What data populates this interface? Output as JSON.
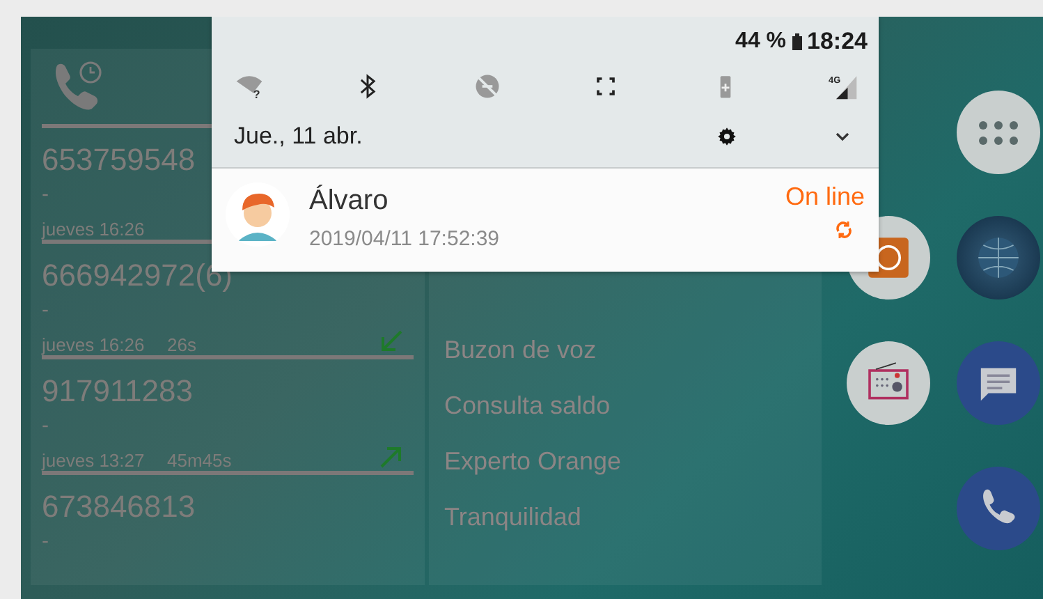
{
  "status_bar": {
    "battery": "44 %",
    "time": "18:24"
  },
  "quick_settings": {
    "wifi_badge": "?",
    "network_type": "4G",
    "date": "Jue., 11 abr."
  },
  "notification": {
    "name": "Álvaro",
    "timestamp": "2019/04/11 17:52:39",
    "status": "On line"
  },
  "call_log": [
    {
      "number": "653759548",
      "note": "-",
      "time": "jueves 16:26"
    },
    {
      "number": "666942972(6)",
      "note": "-",
      "time": "jueves 16:26",
      "duration": "26s",
      "incoming": true
    },
    {
      "number": "917911283",
      "note": "-",
      "time": "jueves 13:27",
      "duration": "45m45s",
      "incoming": false
    },
    {
      "number": "673846813",
      "note": "-"
    }
  ],
  "menu": [
    "Buzon de voz",
    "Consulta saldo",
    "Experto Orange",
    "Tranquilidad"
  ]
}
